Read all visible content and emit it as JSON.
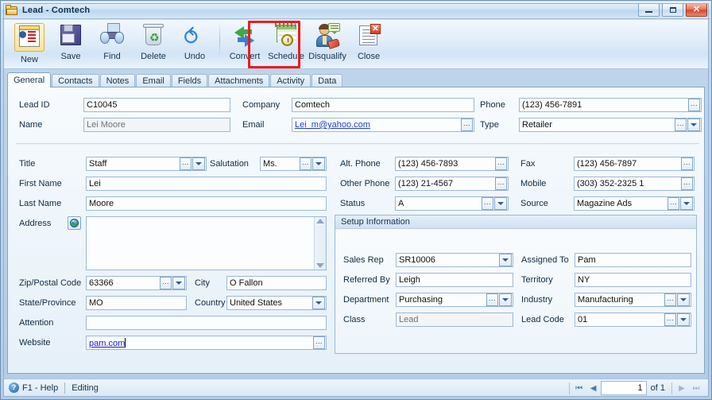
{
  "window": {
    "title": "Lead - Comtech",
    "icon": "folder-lead-icon",
    "buttons": {
      "minimize": "minimize",
      "maximize": "maximize",
      "close": "close"
    }
  },
  "toolbar": {
    "items": [
      {
        "label": "New",
        "icon": "new-record-icon",
        "selected": true
      },
      {
        "label": "Save",
        "icon": "floppy-disk-icon",
        "selected": false
      },
      {
        "label": "Find",
        "icon": "binoculars-icon",
        "selected": false
      },
      {
        "label": "Delete",
        "icon": "recycle-bin-icon",
        "selected": false
      },
      {
        "label": "Undo",
        "icon": "undo-arrow-icon",
        "selected": false
      },
      {
        "label": "Convert",
        "icon": "convert-arrows-icon",
        "selected": false
      },
      {
        "label": "Schedule",
        "icon": "calendar-clock-icon",
        "selected": false
      },
      {
        "label": "Disqualify",
        "icon": "person-tag-icon",
        "selected": false,
        "highlighted": true
      },
      {
        "label": "Close",
        "icon": "document-close-icon",
        "selected": false
      }
    ]
  },
  "tabs": [
    {
      "label": "General",
      "active": true
    },
    {
      "label": "Contacts",
      "active": false
    },
    {
      "label": "Notes",
      "active": false
    },
    {
      "label": "Email",
      "active": false
    },
    {
      "label": "Fields",
      "active": false
    },
    {
      "label": "Attachments",
      "active": false
    },
    {
      "label": "Activity",
      "active": false
    },
    {
      "label": "Data",
      "active": false
    }
  ],
  "form": {
    "lead_id": {
      "label": "Lead ID",
      "value": "C10045"
    },
    "name": {
      "label": "Name",
      "value": "Lei Moore"
    },
    "company": {
      "label": "Company",
      "value": "Comtech"
    },
    "email": {
      "label": "Email",
      "value": "Lei_m@yahoo.com"
    },
    "phone": {
      "label": "Phone",
      "value": "(123) 456-7891"
    },
    "type": {
      "label": "Type",
      "value": "Retailer"
    },
    "title": {
      "label": "Title",
      "value": "Staff"
    },
    "salutation": {
      "label": "Salutation",
      "value": "Ms."
    },
    "first_name": {
      "label": "First Name",
      "value": "Lei"
    },
    "last_name": {
      "label": "Last Name",
      "value": "Moore"
    },
    "address": {
      "label": "Address",
      "value": ""
    },
    "zip": {
      "label": "Zip/Postal Code",
      "value": "63366"
    },
    "city": {
      "label": "City",
      "value": "O Fallon"
    },
    "state": {
      "label": "State/Province",
      "value": "MO"
    },
    "country": {
      "label": "Country",
      "value": "United States"
    },
    "attention": {
      "label": "Attention",
      "value": ""
    },
    "website": {
      "label": "Website",
      "value": "pam.com"
    },
    "alt_phone": {
      "label": "Alt. Phone",
      "value": "(123) 456-7893"
    },
    "fax": {
      "label": "Fax",
      "value": "(123) 456-7897"
    },
    "other_phone": {
      "label": "Other Phone",
      "value": "(123) 21-4567"
    },
    "mobile": {
      "label": "Mobile",
      "value": "(303) 352-2325 1"
    },
    "status": {
      "label": "Status",
      "value": "A"
    },
    "source": {
      "label": "Source",
      "value": "Magazine Ads"
    }
  },
  "setup": {
    "title": "Setup Information",
    "sales_rep": {
      "label": "Sales Rep",
      "value": "SR10006"
    },
    "assigned_to": {
      "label": "Assigned To",
      "value": "Pam"
    },
    "referred_by": {
      "label": "Referred By",
      "value": "Leigh"
    },
    "territory": {
      "label": "Territory",
      "value": "NY"
    },
    "department": {
      "label": "Department",
      "value": "Purchasing"
    },
    "industry": {
      "label": "Industry",
      "value": "Manufacturing"
    },
    "class": {
      "label": "Class",
      "value": "Lead"
    },
    "lead_code": {
      "label": "Lead Code",
      "value": "01"
    }
  },
  "statusbar": {
    "help": "F1 - Help",
    "mode": "Editing",
    "page": "1",
    "of": "of 1"
  },
  "colors": {
    "highlight": "#ef1c1c",
    "link": "#1a3fd0",
    "title_text": "#10314f"
  }
}
